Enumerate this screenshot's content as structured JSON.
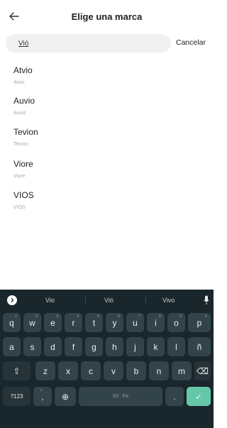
{
  "header": {
    "title": "Elige una marca",
    "back_icon": "arrow-left-icon"
  },
  "search": {
    "value": "Vió",
    "cancel_label": "Cancelar"
  },
  "results": [
    {
      "name": "Atvio",
      "sub": "Atvio"
    },
    {
      "name": "Auvio",
      "sub": "Auvio"
    },
    {
      "name": "Tevion",
      "sub": "Tevion"
    },
    {
      "name": "Viore",
      "sub": "Viore"
    },
    {
      "name": "VIOS",
      "sub": "VIOS"
    }
  ],
  "keyboard": {
    "suggestions": [
      "Vio",
      "Vió",
      "Vivo"
    ],
    "row1": [
      {
        "k": "q",
        "h": "1"
      },
      {
        "k": "w",
        "h": "2"
      },
      {
        "k": "e",
        "h": "3"
      },
      {
        "k": "r",
        "h": "4"
      },
      {
        "k": "t",
        "h": "5"
      },
      {
        "k": "y",
        "h": "6"
      },
      {
        "k": "u",
        "h": "7"
      },
      {
        "k": "i",
        "h": "8"
      },
      {
        "k": "o",
        "h": "9"
      },
      {
        "k": "p",
        "h": "0"
      }
    ],
    "row2": [
      "a",
      "s",
      "d",
      "f",
      "g",
      "h",
      "j",
      "k",
      "l",
      "ñ"
    ],
    "row3": [
      "z",
      "x",
      "c",
      "v",
      "b",
      "n",
      "m"
    ],
    "shift_label": "⇧",
    "backspace_label": "⌫",
    "symbols_label": "?123",
    "comma_label": ",",
    "comma_hint": "☺",
    "globe_label": "⊕",
    "space_label": "ES · EN",
    "period_label": ".",
    "enter_label": "✓",
    "colors": {
      "bg": "#19262b",
      "key": "#33434a",
      "enter": "#64c8a8"
    }
  }
}
